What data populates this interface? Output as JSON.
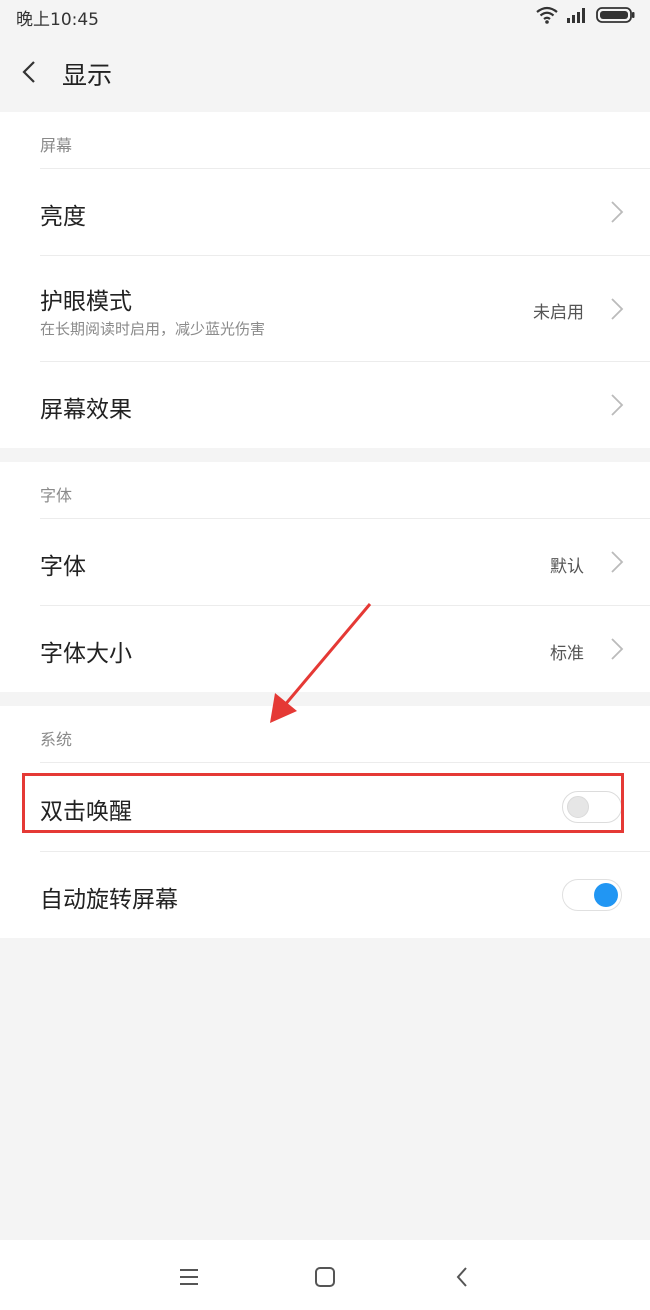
{
  "status_bar": {
    "time": "晚上10:45"
  },
  "header": {
    "title": "显示"
  },
  "sections": {
    "screen": {
      "title": "屏幕",
      "brightness": {
        "label": "亮度"
      },
      "eye_mode": {
        "label": "护眼模式",
        "subtitle": "在长期阅读时启用，减少蓝光伤害",
        "value": "未启用"
      },
      "screen_effect": {
        "label": "屏幕效果"
      }
    },
    "font": {
      "title": "字体",
      "font": {
        "label": "字体",
        "value": "默认"
      },
      "font_size": {
        "label": "字体大小",
        "value": "标准"
      }
    },
    "system": {
      "title": "系统",
      "double_tap_wake": {
        "label": "双击唤醒",
        "enabled": false
      },
      "auto_rotate": {
        "label": "自动旋转屏幕",
        "enabled": true
      }
    }
  },
  "colors": {
    "accent": "#2196f3",
    "annotation": "#e53935"
  },
  "icons": [
    "wifi-icon",
    "signal-icon",
    "battery-icon",
    "back-icon",
    "chevron-right-icon",
    "menu-icon",
    "home-icon",
    "nav-back-icon"
  ]
}
